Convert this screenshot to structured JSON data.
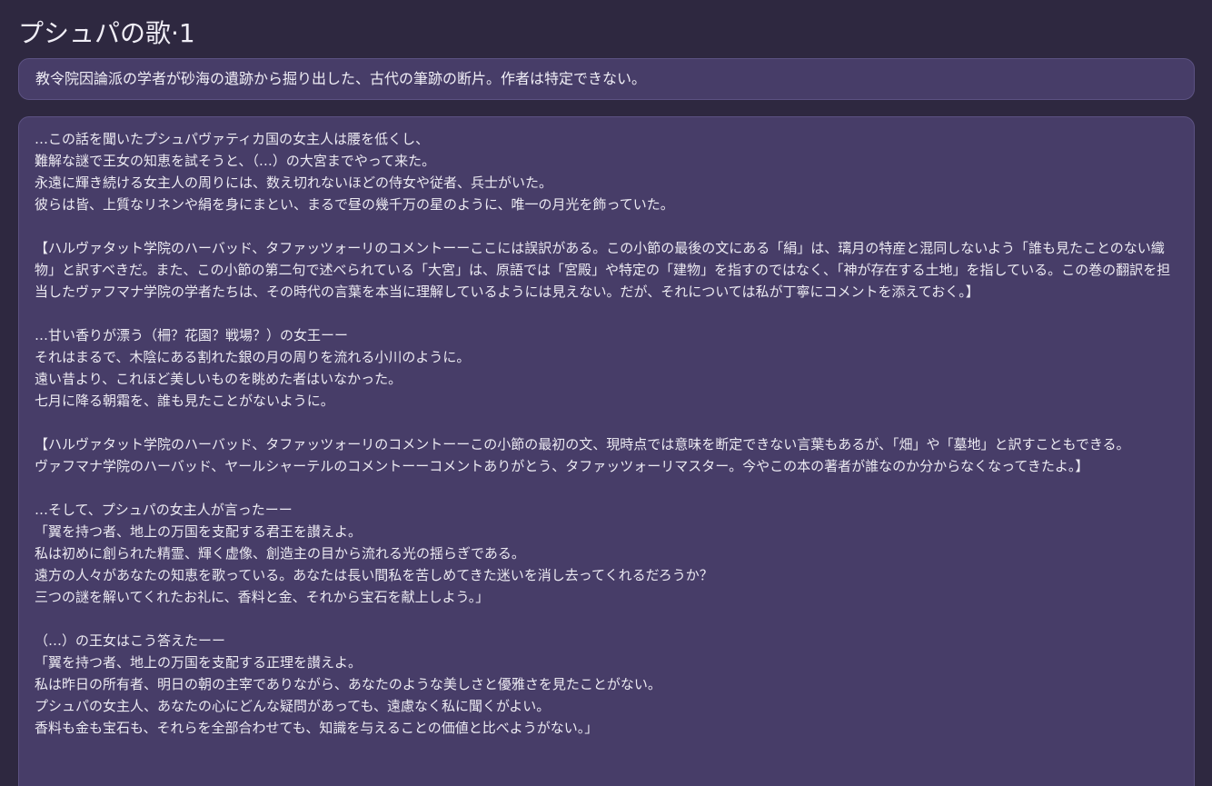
{
  "title": "プシュパの歌·1",
  "description": "教令院因論派の学者が砂海の遺跡から掘り出した、古代の筆跡の断片。作者は特定できない。",
  "body": {
    "p1": [
      "…この話を聞いたプシュパヴァティカ国の女主人は腰を低くし、",
      "難解な謎で王女の知恵を試そうと、（…）の大宮までやって来た。",
      "永遠に輝き続ける女主人の周りには、数え切れないほどの侍女や従者、兵士がいた。",
      "彼らは皆、上質なリネンや絹を身にまとい、まるで昼の幾千万の星のように、唯一の月光を飾っていた。"
    ],
    "p2": [
      "【ハルヴァタット学院のハーバッド、タファッツォーリのコメントーーここには誤訳がある。この小節の最後の文にある「絹」は、璃月の特産と混同しないよう「誰も見たことのない織物」と訳すべきだ。また、この小節の第二句で述べられている「大宮」は、原語では「宮殿」や特定の「建物」を指すのではなく、「神が存在する土地」を指している。この巻の翻訳を担当したヴァフマナ学院の学者たちは、その時代の言葉を本当に理解しているようには見えない。だが、それについては私が丁寧にコメントを添えておく。】"
    ],
    "p3": [
      "…甘い香りが漂う（柵？花園？戦場？）の女王ーー",
      "それはまるで、木陰にある割れた銀の月の周りを流れる小川のように。",
      "遠い昔より、これほど美しいものを眺めた者はいなかった。",
      "七月に降る朝霜を、誰も見たことがないように。"
    ],
    "p4": [
      "【ハルヴァタット学院のハーバッド、タファッツォーリのコメントーーこの小節の最初の文、現時点では意味を断定できない言葉もあるが、「畑」や「墓地」と訳すこともできる。",
      "ヴァフマナ学院のハーバッド、ヤールシャーテルのコメントーーコメントありがとう、タファッツォーリマスター。今やこの本の著者が誰なのか分からなくなってきたよ。】"
    ],
    "p5": [
      "…そして、プシュパの女主人が言ったーー",
      "「翼を持つ者、地上の万国を支配する君王を讃えよ。",
      "私は初めに創られた精霊、輝く虚像、創造主の目から流れる光の揺らぎである。",
      "遠方の人々があなたの知恵を歌っている。あなたは長い間私を苦しめてきた迷いを消し去ってくれるだろうか？",
      "三つの謎を解いてくれたお礼に、香料と金、それから宝石を献上しよう。」"
    ],
    "p6": [
      "（…）の王女はこう答えたーー",
      "「翼を持つ者、地上の万国を支配する正理を讃えよ。",
      "私は昨日の所有者、明日の朝の主宰でありながら、あなたのような美しさと優雅さを見たことがない。",
      "プシュパの女主人、あなたの心にどんな疑問があっても、遠慮なく私に聞くがよい。",
      "香料も金も宝石も、それらを全部合わせても、知識を与えることの価値と比べようがない。」"
    ]
  }
}
